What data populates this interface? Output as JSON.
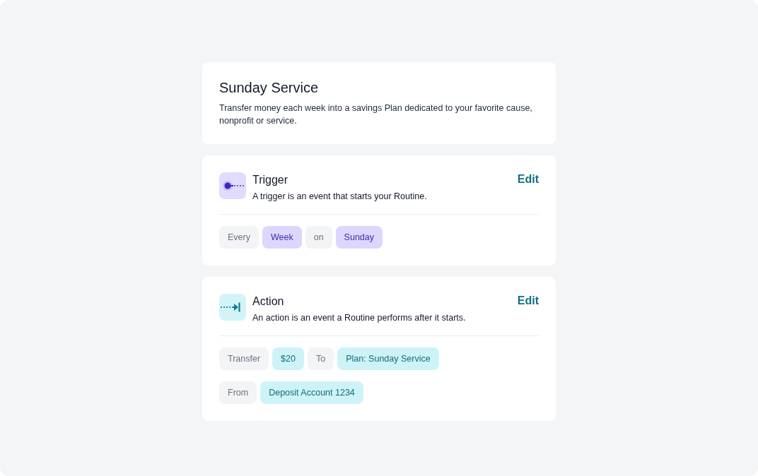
{
  "header": {
    "title": "Sunday Service",
    "description": "Transfer money each week into a savings Plan dedicated to your favorite cause, nonprofit or service."
  },
  "steps": [
    {
      "kind": "trigger",
      "title": "Trigger",
      "description": "A trigger is an event that starts your Routine.",
      "edit_label": "Edit",
      "rows": [
        {
          "chips": [
            {
              "kind": "word",
              "text": "Every"
            },
            {
              "kind": "value",
              "text": "Week"
            },
            {
              "kind": "word",
              "text": "on"
            },
            {
              "kind": "value",
              "text": "Sunday"
            }
          ]
        }
      ]
    },
    {
      "kind": "action",
      "title": "Action",
      "description": "An action is an event a Routine performs after it starts.",
      "edit_label": "Edit",
      "rows": [
        {
          "chips": [
            {
              "kind": "word",
              "text": "Transfer"
            },
            {
              "kind": "value",
              "text": "$20"
            },
            {
              "kind": "word",
              "text": "To"
            },
            {
              "kind": "value",
              "text": "Plan: Sunday Service"
            }
          ]
        },
        {
          "chips": [
            {
              "kind": "word",
              "text": "From"
            },
            {
              "kind": "value",
              "text": "Deposit Account 1234"
            }
          ]
        }
      ]
    }
  ]
}
